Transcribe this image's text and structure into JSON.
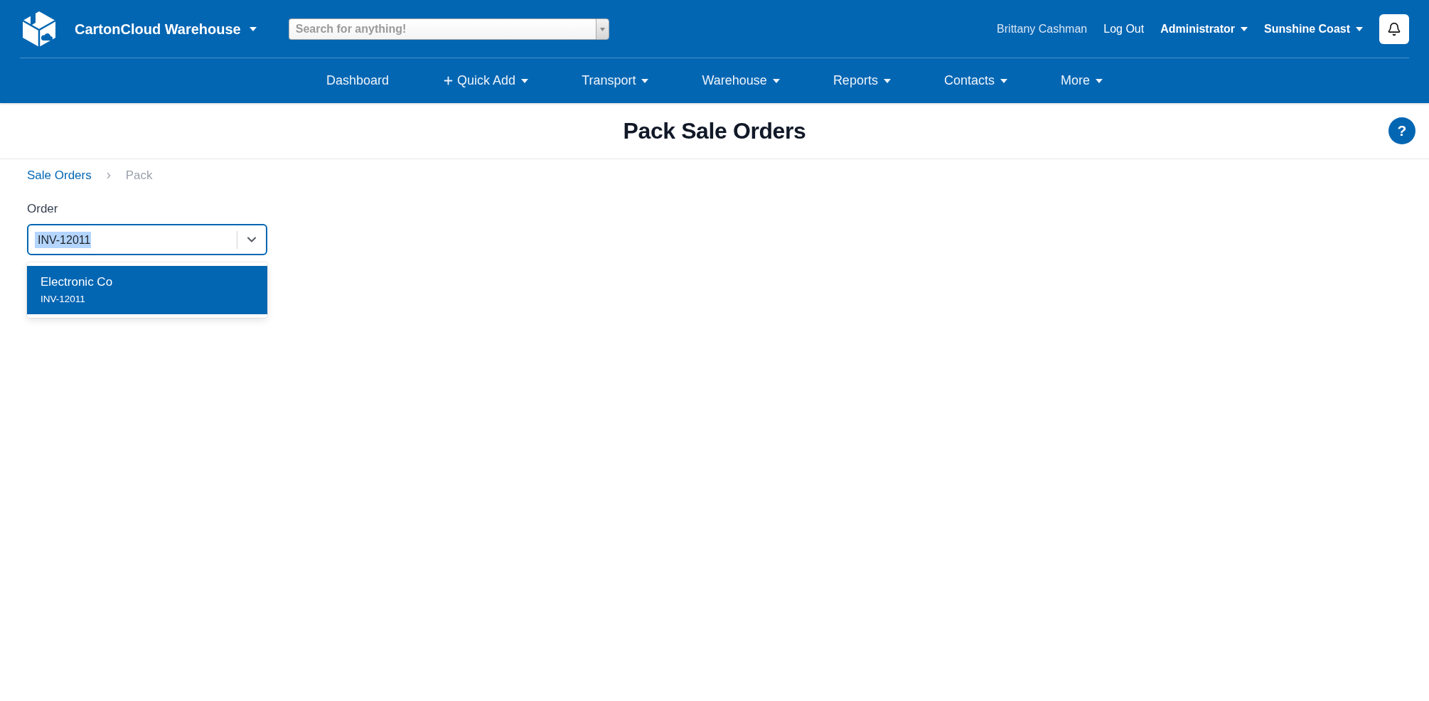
{
  "header": {
    "app_name": "CartonCloud Warehouse",
    "search": {
      "placeholder": "Search for anything!"
    },
    "user_name": "Brittany Cashman",
    "logout": "Log Out",
    "role": "Administrator",
    "location": "Sunshine Coast"
  },
  "nav": [
    {
      "label": "Dashboard",
      "kind": "link"
    },
    {
      "label": "Quick Add",
      "kind": "add-menu"
    },
    {
      "label": "Transport",
      "kind": "menu"
    },
    {
      "label": "Warehouse",
      "kind": "menu"
    },
    {
      "label": "Reports",
      "kind": "menu"
    },
    {
      "label": "Contacts",
      "kind": "menu"
    },
    {
      "label": "More",
      "kind": "menu"
    }
  ],
  "page": {
    "title": "Pack Sale Orders",
    "help_button": "?"
  },
  "breadcrumb": [
    {
      "label": "Sale Orders",
      "current": false
    },
    {
      "label": "Pack",
      "current": true
    }
  ],
  "order_field": {
    "label": "Order",
    "value": "INV-12011",
    "text_selected": true,
    "open": true,
    "options": [
      {
        "name": "Electronic Co",
        "reference": "INV-12011",
        "selected": true
      }
    ]
  }
}
